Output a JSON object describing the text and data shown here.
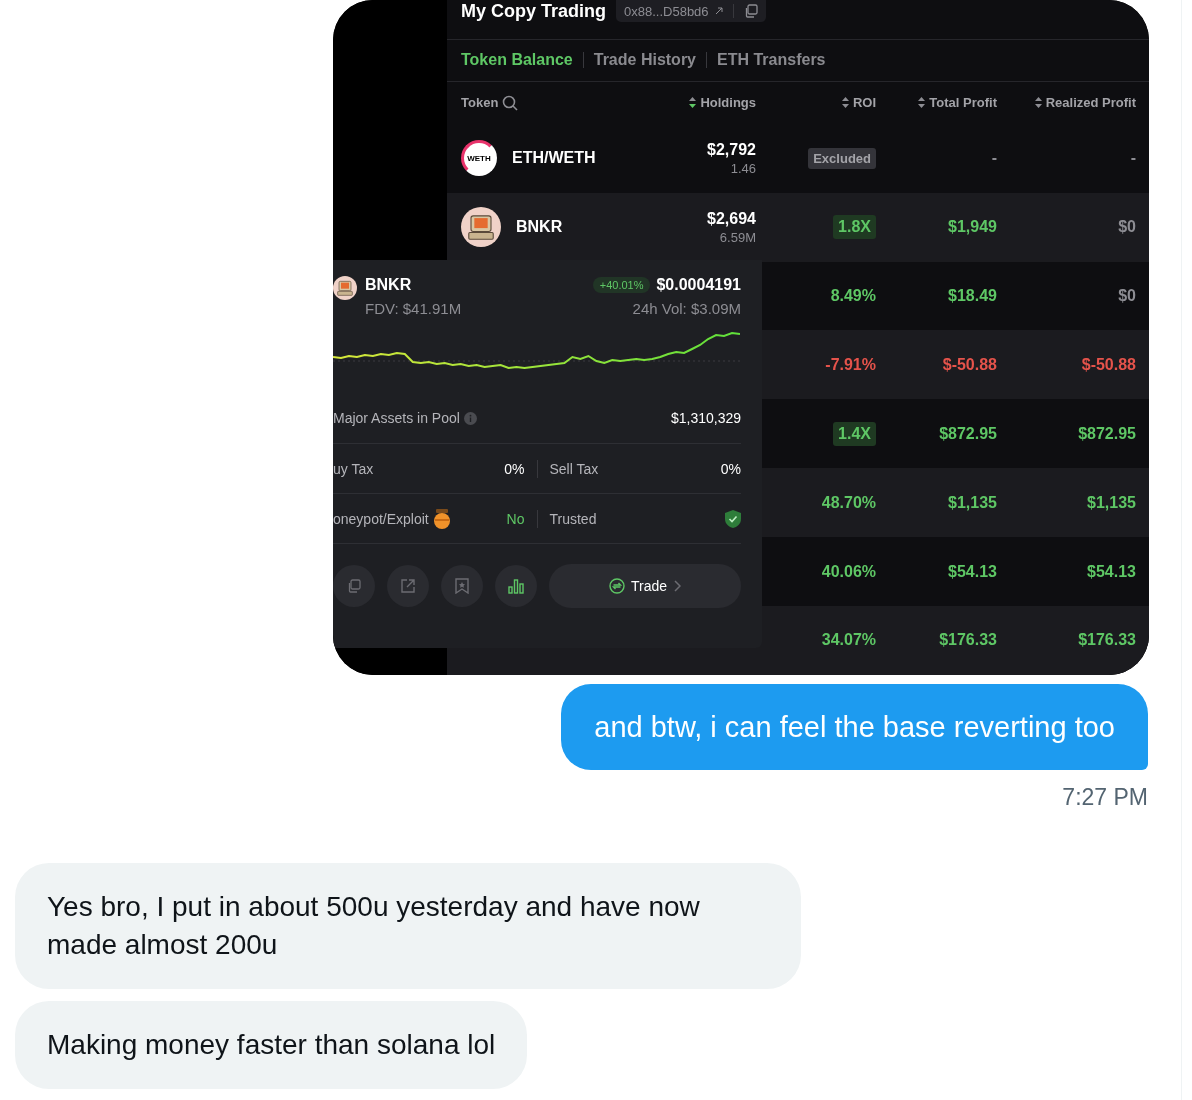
{
  "chat_image": {
    "header": {
      "title": "My Copy Trading",
      "address": "0x88...D58bd6"
    },
    "tabs": [
      {
        "label": "Token Balance",
        "selected": true
      },
      {
        "label": "Trade History",
        "selected": false
      },
      {
        "label": "ETH Transfers",
        "selected": false
      }
    ],
    "columns": [
      {
        "label": "Token",
        "kind": "search"
      },
      {
        "label": "Holdings",
        "kind": "sort",
        "sorted": true
      },
      {
        "label": "ROI",
        "kind": "sort",
        "sorted": false
      },
      {
        "label": "Total Profit",
        "kind": "sort",
        "sorted": false
      },
      {
        "label": "Realized Profit",
        "kind": "sort",
        "sorted": false
      }
    ],
    "rows": [
      {
        "token": {
          "name": "ETH/WETH",
          "kind": "logo",
          "logo_text": "WETH"
        },
        "holdings": {
          "value": "$2,792",
          "amount": "1.46"
        },
        "roi": {
          "text": "Excluded",
          "kind": "excluded"
        },
        "total_profit": {
          "text": "-",
          "color": "#8d8d93"
        },
        "realized_profit": {
          "text": "-",
          "color": "#8d8d93"
        }
      },
      {
        "token": {
          "name": "BNKR",
          "kind": "computer"
        },
        "holdings": {
          "value": "$2,694",
          "amount": "6.59M"
        },
        "roi": {
          "text": "1.8X",
          "kind": "multiplier"
        },
        "total_profit": {
          "text": "$1,949",
          "color": "#5ec765"
        },
        "realized_profit": {
          "text": "$0",
          "color": "#8d8d93"
        }
      },
      {
        "roi": {
          "text": "8.49%",
          "kind": "text",
          "color": "#5ec765"
        },
        "total_profit": {
          "text": "$18.49",
          "color": "#5ec765"
        },
        "realized_profit": {
          "text": "$0",
          "color": "#8d8d93"
        }
      },
      {
        "roi": {
          "text": "-7.91%",
          "kind": "text",
          "color": "#e5534b"
        },
        "total_profit": {
          "text": "$-50.88",
          "color": "#e5534b"
        },
        "realized_profit": {
          "text": "$-50.88",
          "color": "#e5534b"
        }
      },
      {
        "roi": {
          "text": "1.4X",
          "kind": "multiplier"
        },
        "total_profit": {
          "text": "$872.95",
          "color": "#5ec765"
        },
        "realized_profit": {
          "text": "$872.95",
          "color": "#5ec765"
        }
      },
      {
        "roi": {
          "text": "48.70%",
          "kind": "text",
          "color": "#5ec765"
        },
        "total_profit": {
          "text": "$1,135",
          "color": "#5ec765"
        },
        "realized_profit": {
          "text": "$1,135",
          "color": "#5ec765"
        }
      },
      {
        "roi": {
          "text": "40.06%",
          "kind": "text",
          "color": "#5ec765"
        },
        "total_profit": {
          "text": "$54.13",
          "color": "#5ec765"
        },
        "realized_profit": {
          "text": "$54.13",
          "color": "#5ec765"
        }
      },
      {
        "roi": {
          "text": "34.07%",
          "kind": "text",
          "color": "#5ec765"
        },
        "total_profit": {
          "text": "$176.33",
          "color": "#5ec765"
        },
        "realized_profit": {
          "text": "$176.33",
          "color": "#5ec765"
        }
      }
    ],
    "token_popup": {
      "name": "BNKR",
      "fdv": "FDV: $41.91M",
      "change": "+40.01%",
      "price": "$0.0004191",
      "volume": "24h Vol: $3.09M",
      "pool_label": "Major Assets in Pool",
      "pool_value": "$1,310,329",
      "checks": [
        {
          "cells": [
            {
              "label": "uy Tax",
              "kind": "plain",
              "value": "0%",
              "color": "#ffffff"
            },
            {
              "label": "Sell Tax",
              "kind": "plain",
              "value": "0%",
              "color": "#ffffff"
            }
          ]
        },
        {
          "cells": [
            {
              "label": "oneypot/Exploit",
              "kind": "honeypot",
              "value": "No",
              "color": "#5ec765"
            },
            {
              "label": "Trusted",
              "kind": "shield"
            }
          ]
        }
      ],
      "actions": [
        {
          "kind": "copy",
          "active": false
        },
        {
          "kind": "share",
          "active": false
        },
        {
          "kind": "bookmark",
          "active": false
        },
        {
          "kind": "chart",
          "active": true
        }
      ],
      "trade_label": "Trade"
    }
  },
  "thread": [
    {
      "kind": "sent",
      "text": "and btw, i can feel the base reverting too"
    },
    {
      "kind": "timestamp",
      "text": "7:27 PM"
    },
    {
      "kind": "received",
      "text": "Yes bro, I put in about 500u yesterday and have now made almost 200u"
    },
    {
      "kind": "received",
      "text": "Making money faster than solana lol"
    }
  ]
}
